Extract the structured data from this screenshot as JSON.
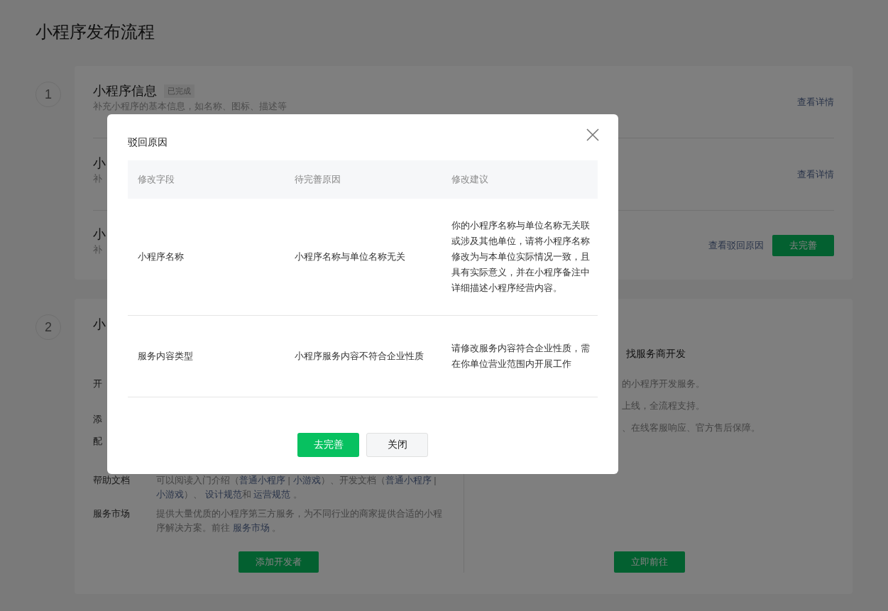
{
  "page_title": "小程序发布流程",
  "step_one": {
    "number": "1",
    "rows": [
      {
        "title": "小程序信息",
        "badge": "已完成",
        "description": "补充小程序的基本信息，如名称、图标、描述等",
        "actions": [
          {
            "kind": "link",
            "label": "查看详情"
          }
        ]
      },
      {
        "title": "小",
        "description": "补",
        "actions": [
          {
            "kind": "link",
            "label": "查看详情"
          }
        ]
      },
      {
        "title": "小",
        "description": "补",
        "actions": [
          {
            "kind": "link",
            "label": "查看驳回原因"
          },
          {
            "kind": "button",
            "label": "去完善"
          }
        ]
      }
    ]
  },
  "step_two": {
    "number": "2",
    "title": "小",
    "left": {
      "items": [
        {
          "label": "开"
        },
        {
          "label": "添"
        },
        {
          "label": "配"
        },
        {
          "label": "帮助文档",
          "segments": [
            {
              "kind": "text",
              "text": "可以阅读入门介绍（"
            },
            {
              "kind": "link",
              "text": "普通小程序"
            },
            {
              "kind": "text",
              "text": " | "
            },
            {
              "kind": "link",
              "text": "小游戏"
            },
            {
              "kind": "text",
              "text": "）、开发文档（"
            },
            {
              "kind": "link",
              "text": "普通小程序"
            },
            {
              "kind": "text",
              "text": " | "
            },
            {
              "kind": "link",
              "text": "小游戏"
            },
            {
              "kind": "text",
              "text": "）、 "
            },
            {
              "kind": "link",
              "text": "设计规范"
            },
            {
              "kind": "text",
              "text": "和 "
            },
            {
              "kind": "link",
              "text": "运营规范"
            },
            {
              "kind": "text",
              "text": " 。"
            }
          ]
        },
        {
          "label": "服务市场",
          "segments": [
            {
              "kind": "text",
              "text": "提供大量优质的小程序第三方服务，为不同行业的商家提供合适的小程序解决方案。前往 "
            },
            {
              "kind": "link",
              "text": "服务市场"
            },
            {
              "kind": "text",
              "text": " 。"
            }
          ]
        }
      ],
      "button": "添加开发者"
    },
    "right": {
      "title": "找服务商开发",
      "lines": [
        "的小程序开发服务。",
        "上线，全流程支持。",
        "、在线客服响应、官方售后保障。"
      ],
      "button": "立即前往"
    }
  },
  "dialog": {
    "title": "驳回原因",
    "columns": [
      "修改字段",
      "待完善原因",
      "修改建议"
    ],
    "rows": [
      [
        "小程序名称",
        "小程序名称与单位名称无关",
        "你的小程序名称与单位名称无关联或涉及其他单位，请将小程序名称修改为与本单位实际情况一致，且具有实际意义，并在小程序备注中详细描述小程序经营内容。"
      ],
      [
        "服务内容类型",
        "小程序服务内容不符合企业性质",
        "请修改服务内容符合企业性质，需在你单位营业范围内开展工作"
      ]
    ],
    "buttons": [
      {
        "kind": "primary",
        "label": "去完善"
      },
      {
        "kind": "default",
        "label": "关闭"
      }
    ]
  }
}
